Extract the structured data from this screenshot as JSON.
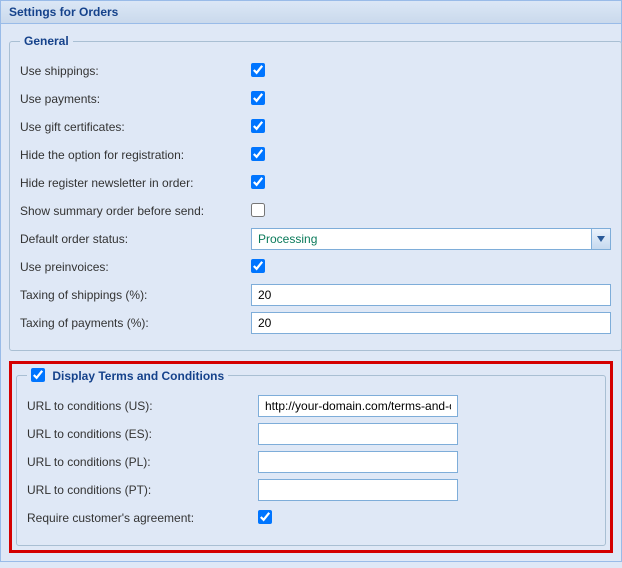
{
  "panel": {
    "title": "Settings for Orders"
  },
  "general": {
    "legend": "General",
    "use_shippings": {
      "label": "Use shippings:",
      "checked": true
    },
    "use_payments": {
      "label": "Use payments:",
      "checked": true
    },
    "use_gift_certificates": {
      "label": "Use gift certificates:",
      "checked": true
    },
    "hide_registration_option": {
      "label": "Hide the option for registration:",
      "checked": true
    },
    "hide_register_newsletter": {
      "label": "Hide register newsletter in order:",
      "checked": true
    },
    "show_summary_before_send": {
      "label": "Show summary order before send:",
      "checked": false
    },
    "default_order_status": {
      "label": "Default order status:",
      "value": "Processing"
    },
    "use_preinvoices": {
      "label": "Use preinvoices:",
      "checked": true
    },
    "taxing_shippings": {
      "label": "Taxing of shippings (%):",
      "value": "20"
    },
    "taxing_payments": {
      "label": "Taxing of payments (%):",
      "value": "20"
    }
  },
  "terms": {
    "legend": "Display Terms and Conditions",
    "enabled": true,
    "url_us": {
      "label": "URL to conditions (US):",
      "value": "http://your-domain.com/terms-and-con"
    },
    "url_es": {
      "label": "URL to conditions (ES):",
      "value": ""
    },
    "url_pl": {
      "label": "URL to conditions (PL):",
      "value": ""
    },
    "url_pt": {
      "label": "URL to conditions (PT):",
      "value": ""
    },
    "require_agreement": {
      "label": "Require customer's agreement:",
      "checked": true
    }
  }
}
